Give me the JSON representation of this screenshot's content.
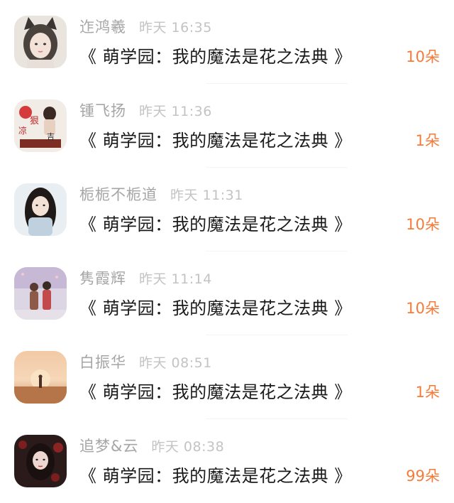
{
  "gifts": [
    {
      "name": "迮鸿羲",
      "time": "昨天 16:35",
      "book": "《 萌学园：我的魔法是花之法典 》",
      "amount": "10朵",
      "avatar": "cat-ear-girl-avatar"
    },
    {
      "name": "锺飞扬",
      "time": "昨天 11:36",
      "book": "《 萌学园：我的魔法是花之法典 》",
      "amount": "1朵",
      "avatar": "cartoon-avatar"
    },
    {
      "name": "栀栀不栀道",
      "time": "昨天 11:31",
      "book": "《 萌学园：我的魔法是花之法典 》",
      "amount": "10朵",
      "avatar": "girl-scarf-avatar"
    },
    {
      "name": "隽霞辉",
      "time": "昨天 11:14",
      "book": "《 萌学园：我的魔法是花之法典 》",
      "amount": "10朵",
      "avatar": "couple-street-avatar"
    },
    {
      "name": "白振华",
      "time": "昨天 08:51",
      "book": "《 萌学园：我的魔法是花之法典 》",
      "amount": "1朵",
      "avatar": "sunset-field-avatar"
    },
    {
      "name": "追梦&云",
      "time": "昨天 08:38",
      "book": "《 萌学园：我的魔法是花之法典 》",
      "amount": "99朵",
      "avatar": "dark-hair-girl-avatar"
    }
  ],
  "colors": {
    "accent": "#f57b3a",
    "name": "#a6a6a6",
    "time": "#c3c3c3",
    "title": "#1a1a1a"
  }
}
